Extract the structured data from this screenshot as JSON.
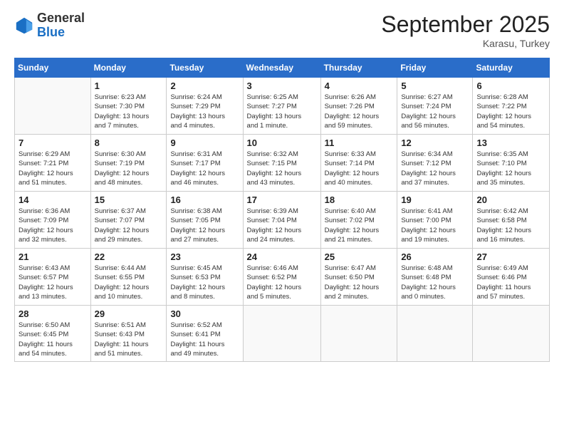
{
  "logo": {
    "general": "General",
    "blue": "Blue"
  },
  "header": {
    "month": "September 2025",
    "location": "Karasu, Turkey"
  },
  "weekdays": [
    "Sunday",
    "Monday",
    "Tuesday",
    "Wednesday",
    "Thursday",
    "Friday",
    "Saturday"
  ],
  "weeks": [
    [
      {
        "day": "",
        "info": ""
      },
      {
        "day": "1",
        "info": "Sunrise: 6:23 AM\nSunset: 7:30 PM\nDaylight: 13 hours\nand 7 minutes."
      },
      {
        "day": "2",
        "info": "Sunrise: 6:24 AM\nSunset: 7:29 PM\nDaylight: 13 hours\nand 4 minutes."
      },
      {
        "day": "3",
        "info": "Sunrise: 6:25 AM\nSunset: 7:27 PM\nDaylight: 13 hours\nand 1 minute."
      },
      {
        "day": "4",
        "info": "Sunrise: 6:26 AM\nSunset: 7:26 PM\nDaylight: 12 hours\nand 59 minutes."
      },
      {
        "day": "5",
        "info": "Sunrise: 6:27 AM\nSunset: 7:24 PM\nDaylight: 12 hours\nand 56 minutes."
      },
      {
        "day": "6",
        "info": "Sunrise: 6:28 AM\nSunset: 7:22 PM\nDaylight: 12 hours\nand 54 minutes."
      }
    ],
    [
      {
        "day": "7",
        "info": "Sunrise: 6:29 AM\nSunset: 7:21 PM\nDaylight: 12 hours\nand 51 minutes."
      },
      {
        "day": "8",
        "info": "Sunrise: 6:30 AM\nSunset: 7:19 PM\nDaylight: 12 hours\nand 48 minutes."
      },
      {
        "day": "9",
        "info": "Sunrise: 6:31 AM\nSunset: 7:17 PM\nDaylight: 12 hours\nand 46 minutes."
      },
      {
        "day": "10",
        "info": "Sunrise: 6:32 AM\nSunset: 7:15 PM\nDaylight: 12 hours\nand 43 minutes."
      },
      {
        "day": "11",
        "info": "Sunrise: 6:33 AM\nSunset: 7:14 PM\nDaylight: 12 hours\nand 40 minutes."
      },
      {
        "day": "12",
        "info": "Sunrise: 6:34 AM\nSunset: 7:12 PM\nDaylight: 12 hours\nand 37 minutes."
      },
      {
        "day": "13",
        "info": "Sunrise: 6:35 AM\nSunset: 7:10 PM\nDaylight: 12 hours\nand 35 minutes."
      }
    ],
    [
      {
        "day": "14",
        "info": "Sunrise: 6:36 AM\nSunset: 7:09 PM\nDaylight: 12 hours\nand 32 minutes."
      },
      {
        "day": "15",
        "info": "Sunrise: 6:37 AM\nSunset: 7:07 PM\nDaylight: 12 hours\nand 29 minutes."
      },
      {
        "day": "16",
        "info": "Sunrise: 6:38 AM\nSunset: 7:05 PM\nDaylight: 12 hours\nand 27 minutes."
      },
      {
        "day": "17",
        "info": "Sunrise: 6:39 AM\nSunset: 7:04 PM\nDaylight: 12 hours\nand 24 minutes."
      },
      {
        "day": "18",
        "info": "Sunrise: 6:40 AM\nSunset: 7:02 PM\nDaylight: 12 hours\nand 21 minutes."
      },
      {
        "day": "19",
        "info": "Sunrise: 6:41 AM\nSunset: 7:00 PM\nDaylight: 12 hours\nand 19 minutes."
      },
      {
        "day": "20",
        "info": "Sunrise: 6:42 AM\nSunset: 6:58 PM\nDaylight: 12 hours\nand 16 minutes."
      }
    ],
    [
      {
        "day": "21",
        "info": "Sunrise: 6:43 AM\nSunset: 6:57 PM\nDaylight: 12 hours\nand 13 minutes."
      },
      {
        "day": "22",
        "info": "Sunrise: 6:44 AM\nSunset: 6:55 PM\nDaylight: 12 hours\nand 10 minutes."
      },
      {
        "day": "23",
        "info": "Sunrise: 6:45 AM\nSunset: 6:53 PM\nDaylight: 12 hours\nand 8 minutes."
      },
      {
        "day": "24",
        "info": "Sunrise: 6:46 AM\nSunset: 6:52 PM\nDaylight: 12 hours\nand 5 minutes."
      },
      {
        "day": "25",
        "info": "Sunrise: 6:47 AM\nSunset: 6:50 PM\nDaylight: 12 hours\nand 2 minutes."
      },
      {
        "day": "26",
        "info": "Sunrise: 6:48 AM\nSunset: 6:48 PM\nDaylight: 12 hours\nand 0 minutes."
      },
      {
        "day": "27",
        "info": "Sunrise: 6:49 AM\nSunset: 6:46 PM\nDaylight: 11 hours\nand 57 minutes."
      }
    ],
    [
      {
        "day": "28",
        "info": "Sunrise: 6:50 AM\nSunset: 6:45 PM\nDaylight: 11 hours\nand 54 minutes."
      },
      {
        "day": "29",
        "info": "Sunrise: 6:51 AM\nSunset: 6:43 PM\nDaylight: 11 hours\nand 51 minutes."
      },
      {
        "day": "30",
        "info": "Sunrise: 6:52 AM\nSunset: 6:41 PM\nDaylight: 11 hours\nand 49 minutes."
      },
      {
        "day": "",
        "info": ""
      },
      {
        "day": "",
        "info": ""
      },
      {
        "day": "",
        "info": ""
      },
      {
        "day": "",
        "info": ""
      }
    ]
  ]
}
